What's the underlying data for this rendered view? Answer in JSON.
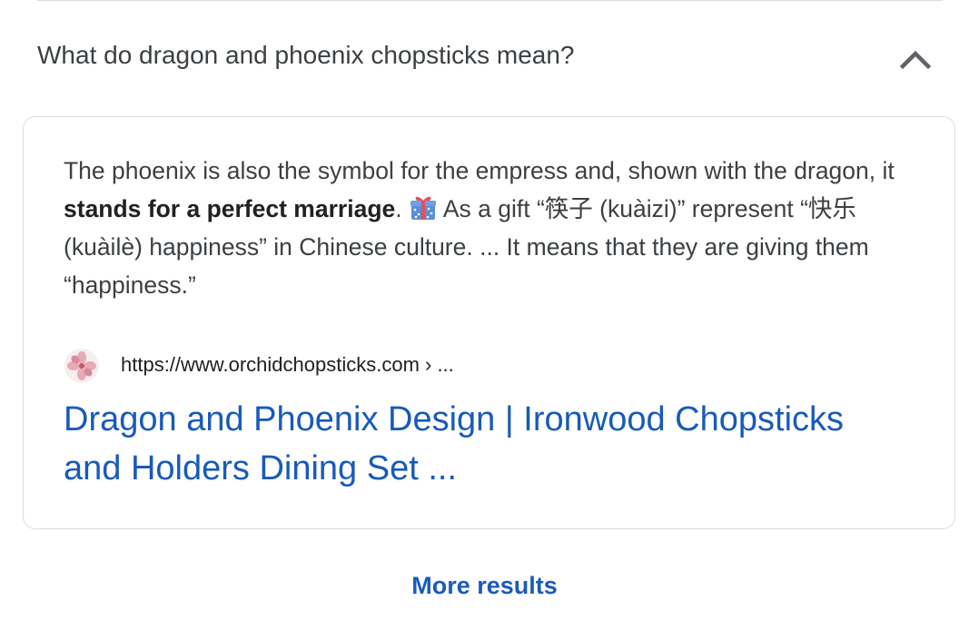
{
  "question": {
    "text": "What do dragon and phoenix chopsticks mean?",
    "toggle_icon": "chevron-up-icon"
  },
  "answer": {
    "snippet_before_bold": "The phoenix is also the symbol for the empress and, shown with the dragon, it ",
    "snippet_bold": "stands for a perfect marriage",
    "snippet_after_bold": ". ",
    "gift_icon": "gift-icon",
    "snippet_rest": " As a gift “筷子 (kuàizi)” represent “快乐 (kuàilè) happiness” in Chinese culture. ... It means that they are giving them “happiness.”",
    "source": {
      "favicon": "cherry-blossom-favicon",
      "url": "https://www.orchidchopsticks.com › ..."
    },
    "result_title": "Dragon and Phoenix Design | Ironwood Chopsticks and Holders Dining Set ..."
  },
  "footer": {
    "more_results_label": "More results"
  },
  "colors": {
    "link": "#185abc",
    "body_text": "#3c4043",
    "border": "#dadce0"
  }
}
